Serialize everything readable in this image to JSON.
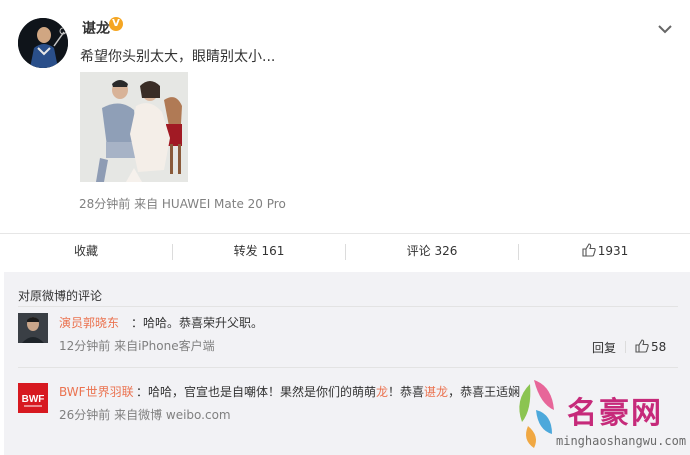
{
  "post": {
    "author": "谌龙",
    "verified_badge": "V",
    "text": "希望你头别太大，眼睛别太小...",
    "meta": "28分钟前 来自 HUAWEI Mate 20 Pro",
    "menu_icon": "chevron-down-icon"
  },
  "actions": {
    "favorite": "收藏",
    "repost": "转发 161",
    "comment": "评论 326",
    "like": "1931"
  },
  "comments": {
    "title": "对原微博的评论",
    "items": [
      {
        "name": "演员郭晓东",
        "text": "：哈哈。恭喜荣升父职。",
        "time": "12分钟前 来自iPhone客户端",
        "reply": "回复",
        "likes": "58"
      },
      {
        "name": "BWF世界羽联",
        "avatar_text": "BWF",
        "text_a": "：哈哈，官宣也是自嘲体！果然是你们的萌萌",
        "hl_a": "龙",
        "text_b": "！恭喜",
        "hl_b": "谌龙",
        "text_c": "，恭喜王适娴",
        "time": "26分钟前 来自微博 weibo.com"
      }
    ]
  },
  "watermark": {
    "title": "名豪网",
    "url": "minghaoshangwu.com"
  },
  "colors": {
    "link": "#eb7350",
    "muted": "#808080",
    "comment_bg": "#f2f2f5",
    "bwf_red": "#d71920"
  }
}
